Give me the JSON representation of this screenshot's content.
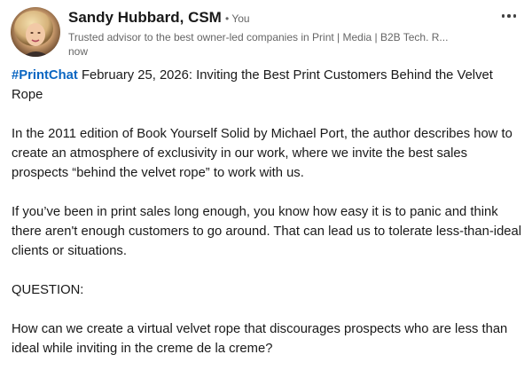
{
  "post": {
    "author": {
      "name": "Sandy Hubbard, CSM",
      "degree": "• You",
      "headline": "Trusted advisor to the best owner-led companies in Print | Media | B2B Tech. R...",
      "timestamp": "now"
    },
    "more_icon": "ellipsis-horizontal-icon",
    "accent_color": "#0a66c2",
    "text": {
      "hashtag": "#PrintChat",
      "p1_rest": " February 25, 2026: Inviting the Best Print Customers Behind the Velvet Rope",
      "p2": "In the 2011 edition of Book Yourself Solid by Michael Port, the author describes how to create an atmosphere of exclusivity in our work, where we invite the best sales prospects “behind the velvet rope” to work with us.",
      "p3": "If you’ve been in print sales long enough, you know how easy it is to panic and think there aren't enough customers to go around. That can lead us to tolerate less-than-ideal clients or situations.",
      "p4": "QUESTION:",
      "p5": "How can we create a virtual velvet rope that discourages prospects who are less than ideal while inviting in the creme de la creme?"
    }
  }
}
